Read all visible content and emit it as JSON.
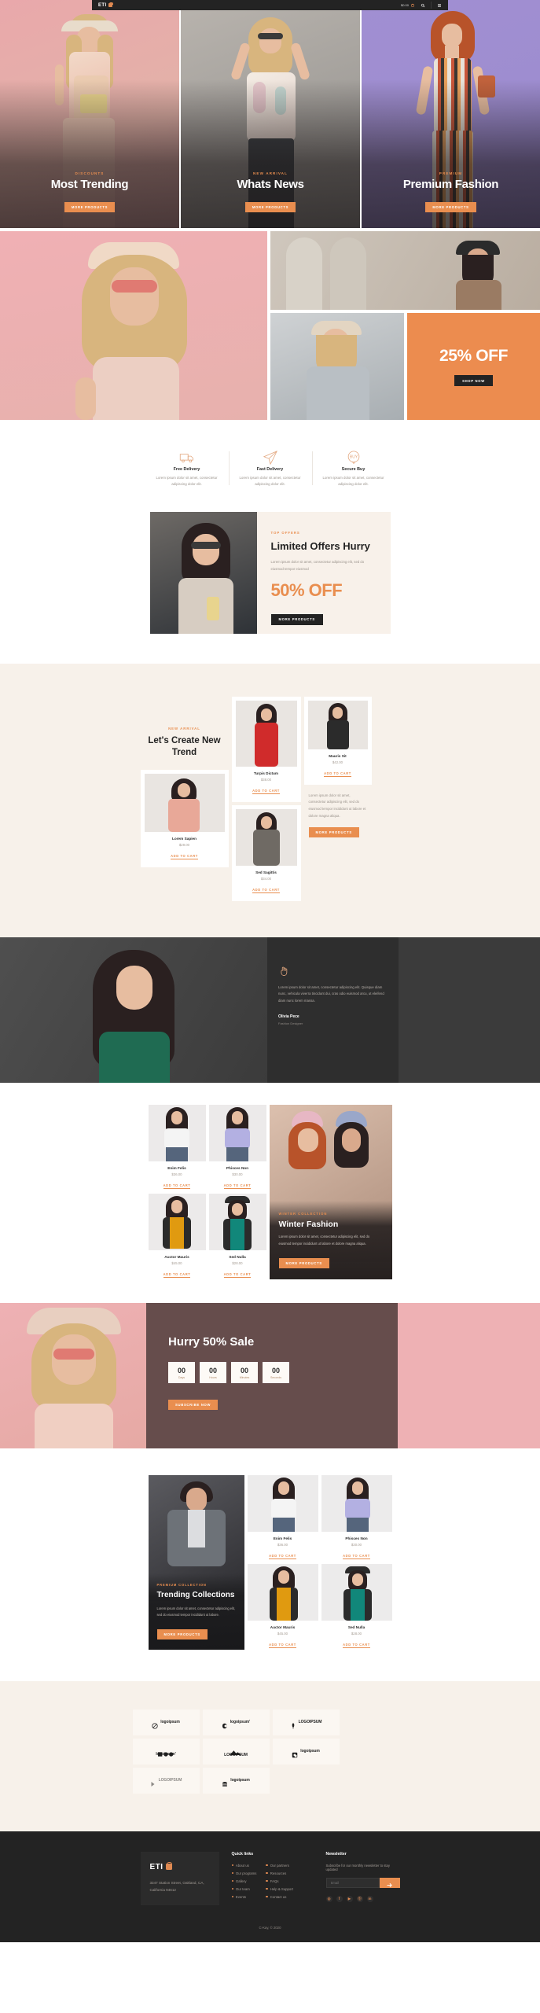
{
  "header": {
    "logo_text": "ETI",
    "logo_icon": "shopping-bag-icon",
    "cart_price": "$0.00",
    "cart_icon": "cart-icon",
    "search_icon": "search-icon",
    "menu_icon": "hamburger-menu-icon"
  },
  "hero": {
    "cards": [
      {
        "kicker": "DISCOUNTS",
        "title": "Most Trending",
        "button": "MORE PRODUCTS"
      },
      {
        "kicker": "NEW ARRIVAL",
        "title": "Whats News",
        "button": "MORE PRODUCTS"
      },
      {
        "kicker": "PREMIUM",
        "title": "Premium Fashion",
        "button": "MORE PRODUCTS"
      }
    ]
  },
  "banners": {
    "offer_text": "25% OFF",
    "offer_button": "SHOP NOW"
  },
  "services": [
    {
      "icon": "delivery-truck-icon",
      "title": "Free Delivery",
      "desc": "Lorem ipsum dolor sit amet, consectetur adipiscing dolor elit."
    },
    {
      "icon": "paper-plane-icon",
      "title": "Fast Delivery",
      "desc": "Lorem ipsum dolor sit amet, consectetur adipiscing dolor elit."
    },
    {
      "icon": "secure-buy-icon",
      "title": "Secure Buy",
      "desc": "Lorem ipsum dolor sit amet, consectetur adipiscing dolor elit."
    }
  ],
  "limited": {
    "kicker": "TOP OFFERS",
    "title": "Limited Offers Hurry",
    "desc": "Lorem ipsum dolor sit amet, consectetur adipiscing elit, sed do eiusmod tempor eiusmod",
    "big": "50% OFF",
    "button": "MORE PRODUCTS"
  },
  "trend": {
    "kicker": "NEW ARRIVAL",
    "title": "Let's Create New Trend",
    "desc": "Lorem ipsum dolor sit amet, consectetur adipiscing elit, sed do eiusmod tempor incididunt ut labore et dolore magna aliqua.",
    "button": "MORE PRODUCTS",
    "products": [
      {
        "name": "Turpis Dictum",
        "price": "$38.00",
        "cart": "ADD TO CART"
      },
      {
        "name": "Mauris Sit",
        "price": "$42.00",
        "cart": "ADD TO CART"
      },
      {
        "name": "Lorem Sapien",
        "price": "$29.00",
        "cart": "ADD TO CART"
      },
      {
        "name": "Sed Sagittis",
        "price": "$34.00",
        "cart": "ADD TO CART"
      }
    ]
  },
  "about": {
    "icon": "hand-ok-icon",
    "desc": "Lorem ipsum dolor sit amet, consectetur adipiscing elit. Quisque diam nunc, vehicula viverra tincidunt dui, cras odio euismod arcu, ut eleifend diam nunc lorem massa.",
    "name": "Olivia Pece",
    "role": "Fashion Designer"
  },
  "products": {
    "items": [
      {
        "name": "Enim Felis",
        "price": "$36.00",
        "cart": "ADD TO CART"
      },
      {
        "name": "Phisces Non",
        "price": "$30.00",
        "cart": "ADD TO CART"
      },
      {
        "name": "Auctor Mauris",
        "price": "$45.00",
        "cart": "ADD TO CART"
      },
      {
        "name": "Sed Nulla",
        "price": "$28.00",
        "cart": "ADD TO CART"
      }
    ]
  },
  "winter": {
    "kicker": "WINTER COLLECTION",
    "title": "Winter Fashion",
    "desc": "Lorem ipsum dolor sit amet, consectetur adipiscing elit, sed do eiusmod tempor incididunt ut labore et dolore magna aliqua.",
    "button": "MORE PRODUCTS"
  },
  "hurry": {
    "title": "Hurry 50% Sale",
    "button": "SUBSCRIBE NOW",
    "countdown": [
      {
        "value": "00",
        "label": "Days"
      },
      {
        "value": "00",
        "label": "Hours"
      },
      {
        "value": "00",
        "label": "Minutes"
      },
      {
        "value": "00",
        "label": "Seconds"
      }
    ]
  },
  "trending": {
    "kicker": "PREMIUM COLLECTION",
    "title": "Trending Collections",
    "desc": "Lorem ipsum dolor sit amet, consectetur adipiscing elit, sed do eiusmod tempor incididunt ut labore.",
    "button": "MORE PRODUCTS",
    "items": [
      {
        "name": "Enim Felis",
        "price": "$36.00",
        "cart": "ADD TO CART"
      },
      {
        "name": "Phisces Non",
        "price": "$30.00",
        "cart": "ADD TO CART"
      },
      {
        "name": "Auctor Mauris",
        "price": "$45.00",
        "cart": "ADD TO CART"
      },
      {
        "name": "Sed Nulla",
        "price": "$28.00",
        "cart": "ADD TO CART"
      }
    ]
  },
  "brands": [
    {
      "name": "logoipsum",
      "mark": "circle-slash-icon",
      "style": "dark"
    },
    {
      "name": "logoipsum'",
      "mark": "half-moon-icon",
      "style": "dark"
    },
    {
      "name": "LOGOIPSUM",
      "mark": "feather-icon",
      "style": "dark"
    },
    {
      "name": "logoipsum'",
      "mark": "three-dots-icon",
      "style": "stack"
    },
    {
      "name": "LOGOIPSUM",
      "mark": "mountain-icon",
      "style": "stack"
    },
    {
      "name": "logoipsum",
      "mark": "square-dot-icon",
      "style": "dark"
    },
    {
      "name": "LOGOIPSUM",
      "mark": "play-flag-icon",
      "style": "gray"
    },
    {
      "name": "logoipsum",
      "mark": "burger-icon",
      "style": "dark"
    }
  ],
  "footer": {
    "logo_text": "ETI",
    "logo_icon": "shopping-bag-icon",
    "address": "3347 Station Street, Oakland, CA, California 94612",
    "quick_links_heading": "Quick links",
    "links_col1": [
      "About us",
      "Our programs",
      "Gallery",
      "Our team",
      "Events"
    ],
    "links_col2": [
      "Our partners",
      "Resources",
      "FAQs",
      "Help & Support",
      "Contact us"
    ],
    "newsletter_heading": "Newsletter",
    "newsletter_sub": "Subscribe for our monthly newsletter to stay updated",
    "email_placeholder": "Email",
    "send_icon": "arrow-right-icon",
    "socials": [
      "instagram-icon",
      "facebook-icon",
      "youtube-icon",
      "dribbble-icon",
      "linkedin-icon"
    ],
    "social_glyphs": [
      "◎",
      "f",
      "▶",
      "ⓑ",
      "in"
    ],
    "copyright": "C-Kay, © 2020"
  },
  "colors": {
    "accent": "#e98e4f",
    "dark": "#232323",
    "cream": "#f7f1ea",
    "pink": "#eeb1b4"
  }
}
